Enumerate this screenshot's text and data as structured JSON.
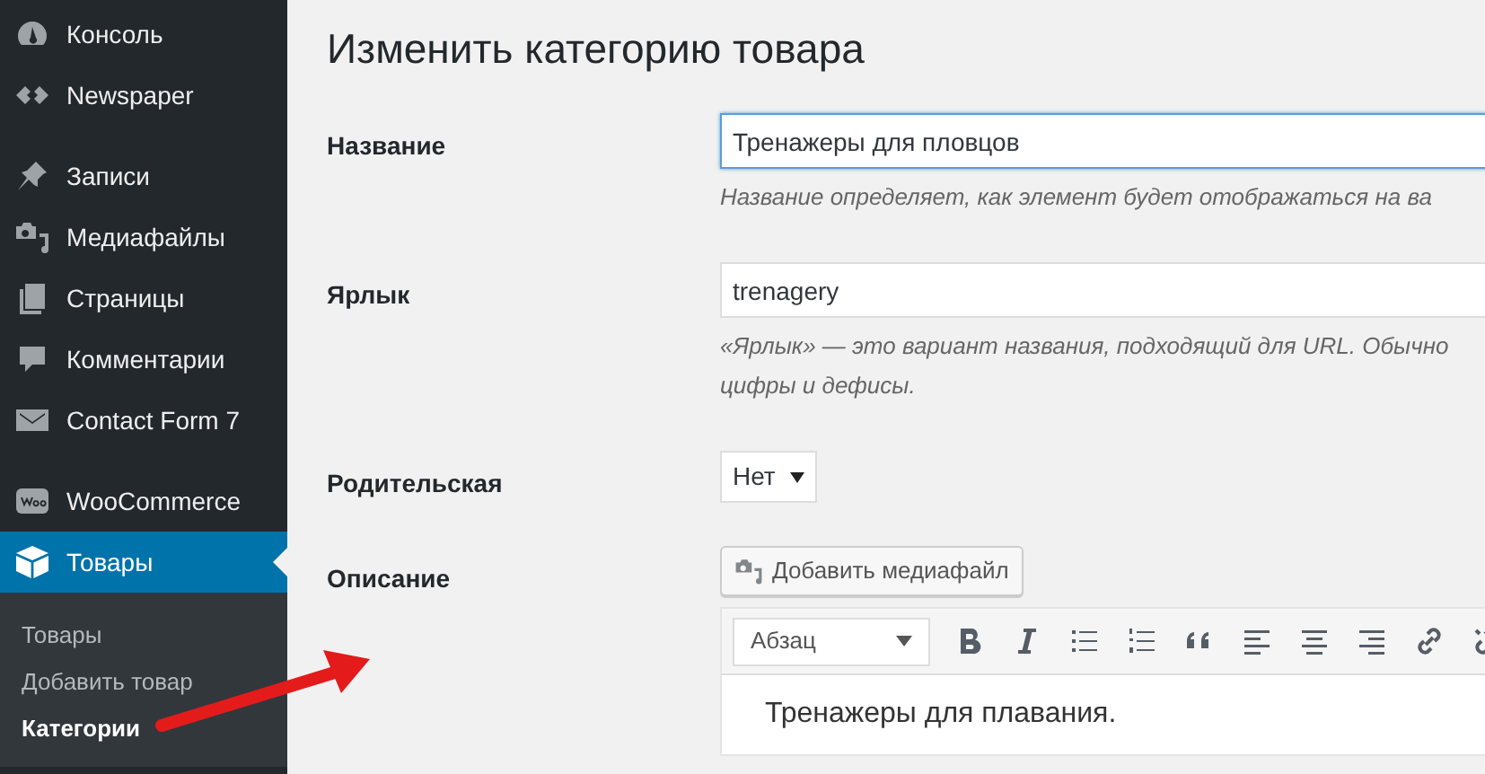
{
  "sidebar": {
    "menu_groups": [
      [
        {
          "label": "Консоль",
          "selected": false
        },
        {
          "label": "Newspaper",
          "selected": false
        }
      ],
      [
        {
          "label": "Записи",
          "selected": false
        },
        {
          "label": "Медиафайлы",
          "selected": false
        },
        {
          "label": "Страницы",
          "selected": false
        },
        {
          "label": "Комментарии",
          "selected": false
        },
        {
          "label": "Contact Form 7",
          "selected": false
        }
      ],
      [
        {
          "label": "WooCommerce",
          "selected": false
        },
        {
          "label": "Товары",
          "selected": true
        }
      ]
    ],
    "submenu": [
      {
        "label": "Товары",
        "selected": false
      },
      {
        "label": "Добавить товар",
        "selected": false
      },
      {
        "label": "Категории",
        "selected": true
      }
    ]
  },
  "page_title": "Изменить категорию товара",
  "form": {
    "name": {
      "label": "Название",
      "value": "Тренажеры для пловцов",
      "focused": true,
      "hint": [
        "Название определяет, как элемент будет отображаться на ва"
      ]
    },
    "slug": {
      "label": "Ярлык",
      "value": "trenagery",
      "focused": false,
      "hint": [
        "«Ярлык» — это вариант названия, подходящий для URL. Обычно",
        "цифры и дефисы."
      ]
    },
    "parent": {
      "label": "Родительская",
      "value": "Нет"
    },
    "description": {
      "label": "Описание",
      "add_media_button": "Добавить медиафайл",
      "format": "Абзац",
      "content": "Тренажеры для плавания."
    }
  }
}
